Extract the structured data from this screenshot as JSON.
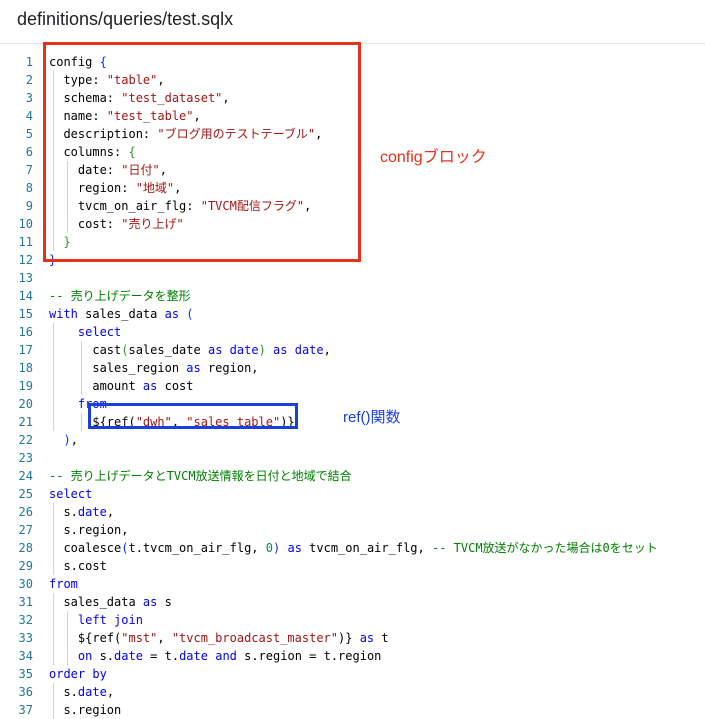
{
  "header": {
    "file_path": "definitions/queries/test.sqlx"
  },
  "annotations": {
    "config_block": "configブロック",
    "ref_function": "ref()関数"
  },
  "colors": {
    "highlight_red": "#e8311a",
    "highlight_blue": "#1a3fe0",
    "keyword": "#0000ff",
    "string": "#a31515",
    "comment": "#008000",
    "number": "#098658",
    "line_number": "#237893"
  },
  "code_lines": [
    {
      "n": "1",
      "t": [
        [
          "config ",
          ""
        ],
        [
          "{",
          "br1"
        ]
      ]
    },
    {
      "n": "2",
      "t": [
        [
          "  type: ",
          ""
        ],
        [
          "\"table\"",
          "str"
        ],
        [
          ",",
          ""
        ]
      ]
    },
    {
      "n": "3",
      "t": [
        [
          "  schema: ",
          ""
        ],
        [
          "\"test_dataset\"",
          "str"
        ],
        [
          ",",
          ""
        ]
      ]
    },
    {
      "n": "4",
      "t": [
        [
          "  name: ",
          ""
        ],
        [
          "\"test_table\"",
          "str"
        ],
        [
          ",",
          ""
        ]
      ]
    },
    {
      "n": "5",
      "t": [
        [
          "  description: ",
          ""
        ],
        [
          "\"ブログ用のテストテーブル\"",
          "str"
        ],
        [
          ",",
          ""
        ]
      ]
    },
    {
      "n": "6",
      "t": [
        [
          "  columns: ",
          ""
        ],
        [
          "{",
          "br2"
        ]
      ]
    },
    {
      "n": "7",
      "t": [
        [
          "    date: ",
          ""
        ],
        [
          "\"日付\"",
          "str"
        ],
        [
          ",",
          ""
        ]
      ]
    },
    {
      "n": "8",
      "t": [
        [
          "    region: ",
          ""
        ],
        [
          "\"地域\"",
          "str"
        ],
        [
          ",",
          ""
        ]
      ]
    },
    {
      "n": "9",
      "t": [
        [
          "    tvcm_on_air_flg: ",
          ""
        ],
        [
          "\"TVCM配信フラグ\"",
          "str"
        ],
        [
          ",",
          ""
        ]
      ]
    },
    {
      "n": "10",
      "t": [
        [
          "    cost: ",
          ""
        ],
        [
          "\"売り上げ\"",
          "str"
        ]
      ]
    },
    {
      "n": "11",
      "t": [
        [
          "  ",
          ""
        ],
        [
          "}",
          "br2"
        ]
      ]
    },
    {
      "n": "12",
      "t": [
        [
          "}",
          "br1"
        ]
      ]
    },
    {
      "n": "13",
      "t": []
    },
    {
      "n": "14",
      "t": [
        [
          "-- 売り上げデータを整形",
          "cm"
        ]
      ]
    },
    {
      "n": "15",
      "t": [
        [
          "with",
          "kw"
        ],
        [
          " sales_data ",
          ""
        ],
        [
          "as",
          "kw"
        ],
        [
          " ",
          ""
        ],
        [
          "(",
          "br1"
        ]
      ]
    },
    {
      "n": "16",
      "t": [
        [
          "    ",
          ""
        ],
        [
          "select",
          "kw"
        ]
      ]
    },
    {
      "n": "17",
      "t": [
        [
          "      cast",
          ""
        ],
        [
          "(",
          "br2"
        ],
        [
          "sales_date ",
          ""
        ],
        [
          "as",
          "kw"
        ],
        [
          " ",
          ""
        ],
        [
          "date",
          "kw"
        ],
        [
          ")",
          "br2"
        ],
        [
          " ",
          ""
        ],
        [
          "as",
          "kw"
        ],
        [
          " ",
          ""
        ],
        [
          "date",
          "kw"
        ],
        [
          ",",
          ""
        ]
      ]
    },
    {
      "n": "18",
      "t": [
        [
          "      sales_region ",
          ""
        ],
        [
          "as",
          "kw"
        ],
        [
          " region,",
          ""
        ]
      ]
    },
    {
      "n": "19",
      "t": [
        [
          "      amount ",
          ""
        ],
        [
          "as",
          "kw"
        ],
        [
          " cost",
          ""
        ]
      ]
    },
    {
      "n": "20",
      "t": [
        [
          "    ",
          ""
        ],
        [
          "from",
          "kw"
        ]
      ]
    },
    {
      "n": "21",
      "t": [
        [
          "      ${ref(",
          ""
        ],
        [
          "\"dwh\"",
          "str"
        ],
        [
          ", ",
          ""
        ],
        [
          "\"sales_table\"",
          "str"
        ],
        [
          ")}",
          ""
        ]
      ]
    },
    {
      "n": "22",
      "t": [
        [
          "  ",
          ""
        ],
        [
          ")",
          "br1"
        ],
        [
          ",",
          ""
        ]
      ]
    },
    {
      "n": "23",
      "t": []
    },
    {
      "n": "24",
      "t": [
        [
          "-- 売り上げデータとTVCM放送情報を日付と地域で結合",
          "cm"
        ]
      ]
    },
    {
      "n": "25",
      "t": [
        [
          "select",
          "kw"
        ]
      ]
    },
    {
      "n": "26",
      "t": [
        [
          "  s.",
          ""
        ],
        [
          "date",
          "kw"
        ],
        [
          ",",
          ""
        ]
      ]
    },
    {
      "n": "27",
      "t": [
        [
          "  s.region,",
          ""
        ]
      ]
    },
    {
      "n": "28",
      "t": [
        [
          "  coalesce",
          ""
        ],
        [
          "(",
          "br1"
        ],
        [
          "t.tvcm_on_air_flg, ",
          ""
        ],
        [
          "0",
          "num"
        ],
        [
          ")",
          "br1"
        ],
        [
          " ",
          ""
        ],
        [
          "as",
          "kw"
        ],
        [
          " tvcm_on_air_flg, ",
          ""
        ],
        [
          "-- TVCM放送がなかった場合は0をセット",
          "cm"
        ]
      ]
    },
    {
      "n": "29",
      "t": [
        [
          "  s.cost",
          ""
        ]
      ]
    },
    {
      "n": "30",
      "t": [
        [
          "from",
          "kw"
        ]
      ]
    },
    {
      "n": "31",
      "t": [
        [
          "  sales_data ",
          ""
        ],
        [
          "as",
          "kw"
        ],
        [
          " s",
          ""
        ]
      ]
    },
    {
      "n": "32",
      "t": [
        [
          "    ",
          ""
        ],
        [
          "left",
          "kw"
        ],
        [
          " ",
          ""
        ],
        [
          "join",
          "kw"
        ]
      ]
    },
    {
      "n": "33",
      "t": [
        [
          "    ${ref(",
          ""
        ],
        [
          "\"mst\"",
          "str"
        ],
        [
          ", ",
          ""
        ],
        [
          "\"tvcm_broadcast_master\"",
          "str"
        ],
        [
          ")}",
          ""
        ],
        [
          " ",
          ""
        ],
        [
          "as",
          "kw"
        ],
        [
          " t",
          ""
        ]
      ]
    },
    {
      "n": "34",
      "t": [
        [
          "    ",
          ""
        ],
        [
          "on",
          "kw"
        ],
        [
          " s.",
          ""
        ],
        [
          "date",
          "kw"
        ],
        [
          " = t.",
          ""
        ],
        [
          "date",
          "kw"
        ],
        [
          " ",
          ""
        ],
        [
          "and",
          "kw"
        ],
        [
          " s.region = t.region",
          ""
        ]
      ]
    },
    {
      "n": "35",
      "t": [
        [
          "order by",
          "kw"
        ]
      ]
    },
    {
      "n": "36",
      "t": [
        [
          "  s.",
          ""
        ],
        [
          "date",
          "kw"
        ],
        [
          ",",
          ""
        ]
      ]
    },
    {
      "n": "37",
      "t": [
        [
          "  s.region",
          ""
        ]
      ]
    }
  ]
}
